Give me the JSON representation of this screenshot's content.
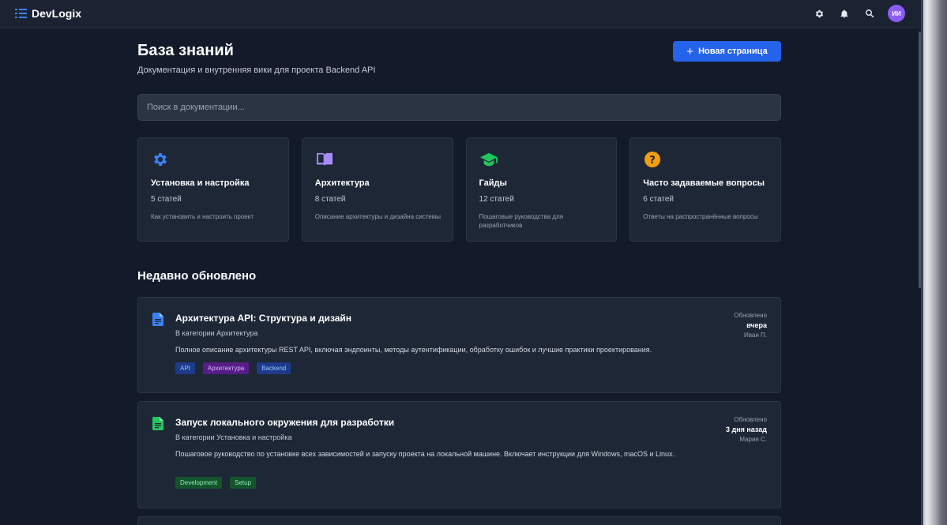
{
  "app": {
    "name": "DevLogix"
  },
  "header": {
    "title": "База знаний",
    "subtitle": "Документация и внутренняя вики для проекта Backend API",
    "new_page_label": "Новая страница",
    "avatar_initials": "ИИ"
  },
  "search": {
    "placeholder": "Поиск в документации..."
  },
  "categories": [
    {
      "name": "Установка и настройка",
      "count": "5 статей",
      "description": "Как установить и настроить проект",
      "icon": "gear-icon",
      "color": "#3b82f6"
    },
    {
      "name": "Архитектура",
      "count": "8 статей",
      "description": "Описание архитектуры и дизайна системы",
      "icon": "book-icon",
      "color": "#a78bfa"
    },
    {
      "name": "Гайды",
      "count": "12 статей",
      "description": "Пошаговые руководства для разработчиков",
      "icon": "graduation-cap-icon",
      "color": "#22c55e"
    },
    {
      "name": "Часто задаваемые вопросы",
      "count": "6 статей",
      "description": "Ответы на распространённые вопросы",
      "icon": "question-icon",
      "color": "#f59e0b"
    }
  ],
  "recent": {
    "title": "Недавно обновлено",
    "items": [
      {
        "title": "Архитектура API: Структура и дизайн",
        "category": "В категории Архитектура",
        "description": "Полное описание архитектуры REST API, включая эндпоинты, методы аутентификации, обработку ошибок и лучшие практики проектирования.",
        "tags": [
          "API",
          "Архитектура",
          "Backend"
        ],
        "updated_label": "Обновлено",
        "updated_when": "вчера",
        "author": "Иван П.",
        "icon_color": "#3b82f6"
      },
      {
        "title": "Запуск локального окружения для разработки",
        "category": "В категории Установка и настройка",
        "description": "Пошаговое руководство по установке всех зависимостей и запуску проекта на локальной машине. Включает инструкции для Windows, macOS и Linux.",
        "tags": [
          "Development",
          "Setup"
        ],
        "updated_label": "Обновлено",
        "updated_when": "3 дня назад",
        "author": "Мария С.",
        "icon_color": "#22c55e"
      }
    ]
  }
}
